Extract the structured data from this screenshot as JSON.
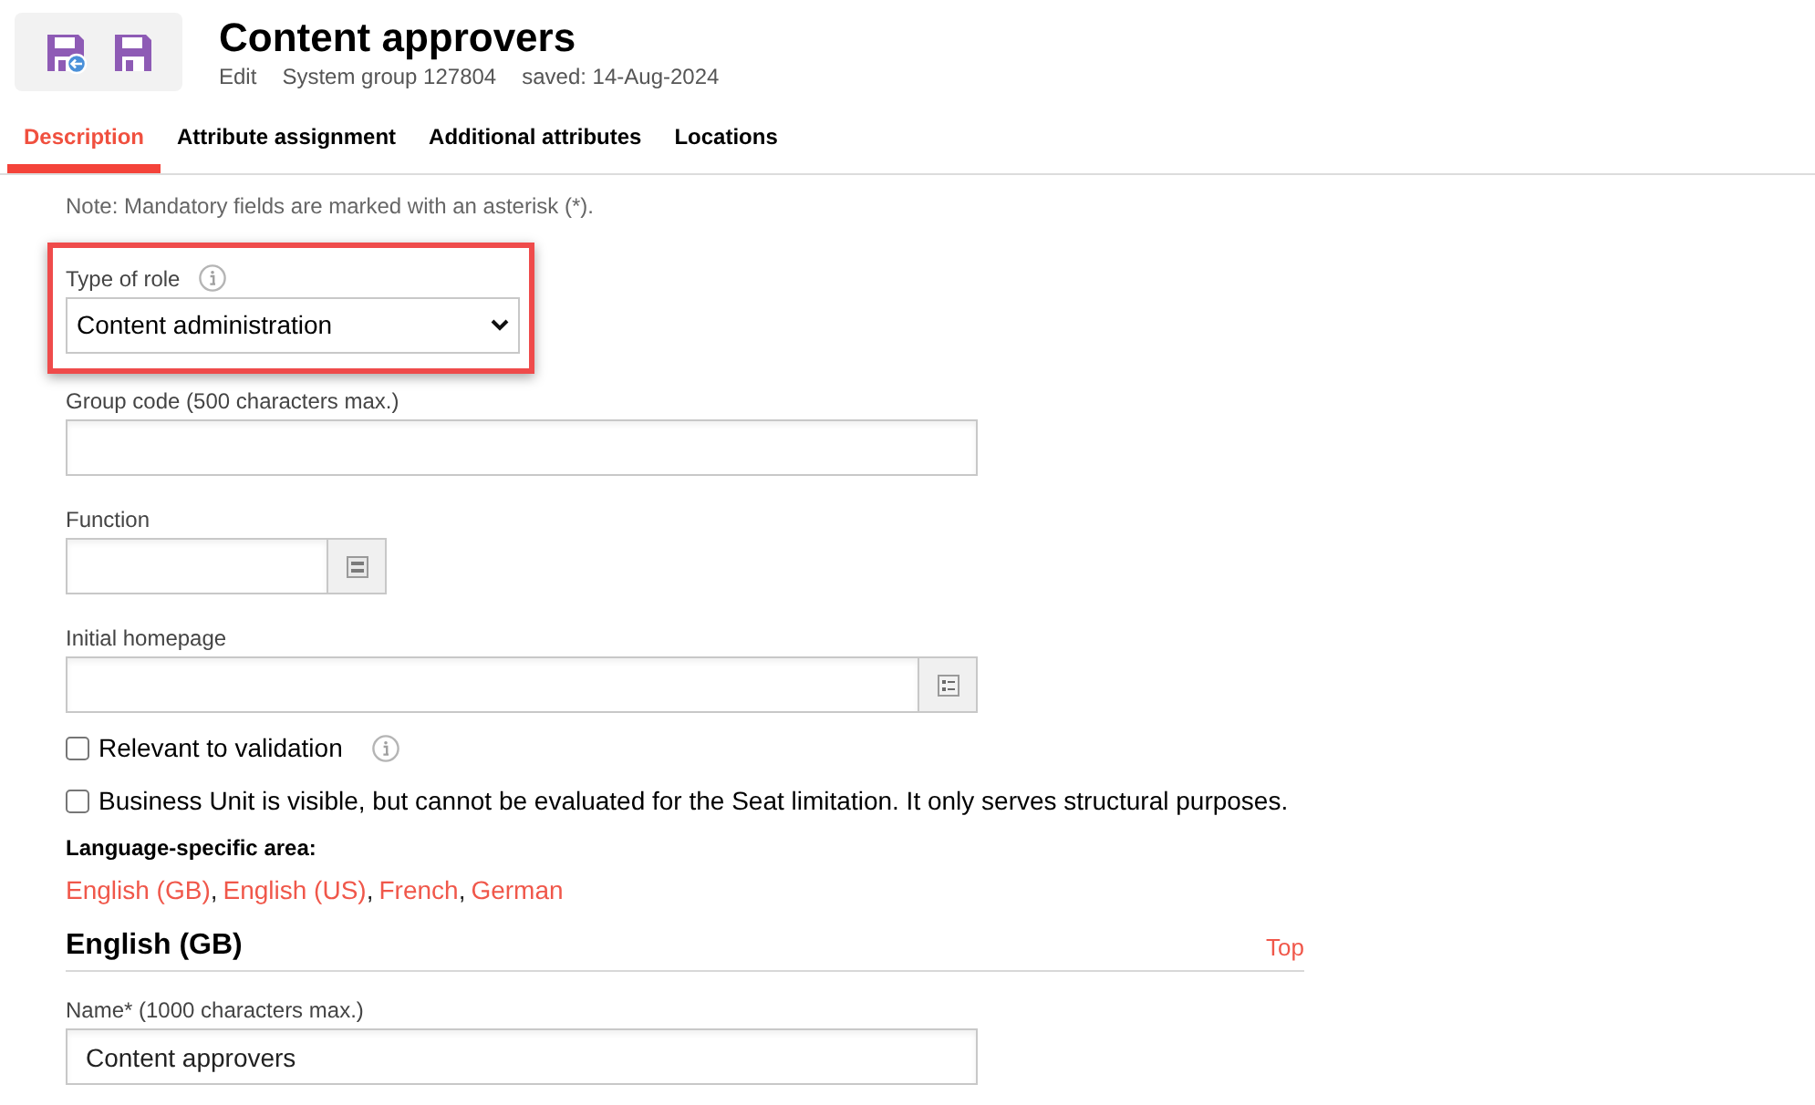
{
  "header": {
    "title": "Content approvers",
    "meta": [
      "Edit",
      "System group 127804",
      "saved: 14-Aug-2024"
    ]
  },
  "tabs": [
    {
      "label": "Description",
      "selected": true
    },
    {
      "label": "Attribute assignment",
      "selected": false
    },
    {
      "label": "Additional attributes",
      "selected": false
    },
    {
      "label": "Locations",
      "selected": false
    }
  ],
  "note": "Note: Mandatory fields are marked with an asterisk (*).",
  "role": {
    "label": "Type of role",
    "value": "Content administration",
    "highlighted": true
  },
  "fields": [
    {
      "kind": "text",
      "label": "Group code (500 characters max.)"
    },
    {
      "kind": "lookup",
      "label": "Function"
    },
    {
      "kind": "list-lookup",
      "label": "Initial homepage"
    }
  ],
  "checkboxes": [
    {
      "label": "Relevant to validation",
      "checked": false,
      "info": true
    },
    {
      "label": "Business Unit is visible, but cannot be evaluated for the Seat limitation. It only serves structural purposes.",
      "checked": false,
      "info": false
    }
  ],
  "language_area": {
    "label": "Language-specific area:",
    "links": [
      {
        "label": "English (GB)",
        "separator": ","
      },
      {
        "label": "English (US)",
        "separator": ","
      },
      {
        "label": "French",
        "separator": ","
      },
      {
        "label": "German"
      }
    ]
  },
  "sections": [
    {
      "heading": "English (GB)",
      "top_link": "Top",
      "fields": [
        {
          "kind": "text",
          "label": "Name* (1000 characters max.)",
          "value": "Content approvers"
        }
      ]
    }
  ]
}
